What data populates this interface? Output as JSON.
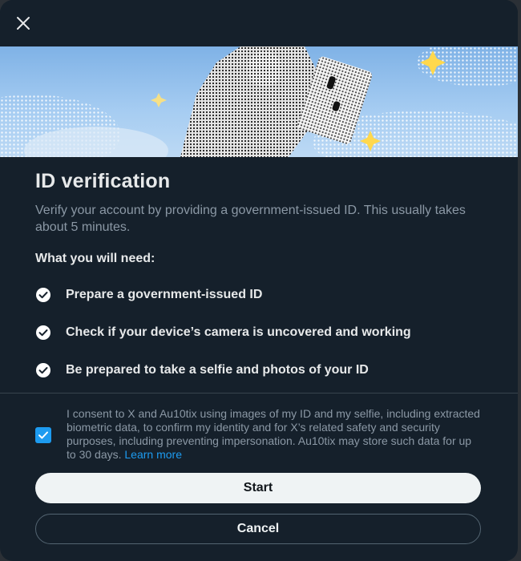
{
  "dialog": {
    "close_icon": "close-icon",
    "title": "ID verification",
    "subtitle": "Verify your account by providing a government-issued ID. This usually takes about 5 minutes.",
    "need_heading": "What you will need:",
    "requirements": [
      "Prepare a government-issued ID",
      "Check if your device’s camera is uncovered and working",
      "Be prepared to take a selfie and photos of your ID"
    ],
    "consent": {
      "checked": true,
      "text": "I consent to X and Au10tix using images of my ID and my selfie, including extracted biometric data, to confirm my identity and for X’s related safety and security purposes, including preventing impersonation. Au10tix may store such data for up to 30 days.",
      "link_label": "Learn more"
    },
    "start_label": "Start",
    "cancel_label": "Cancel"
  },
  "colors": {
    "background": "#15202b",
    "accent": "#1d9bf0",
    "primary_button": "#eff3f4",
    "muted_text": "#8b98a5"
  }
}
